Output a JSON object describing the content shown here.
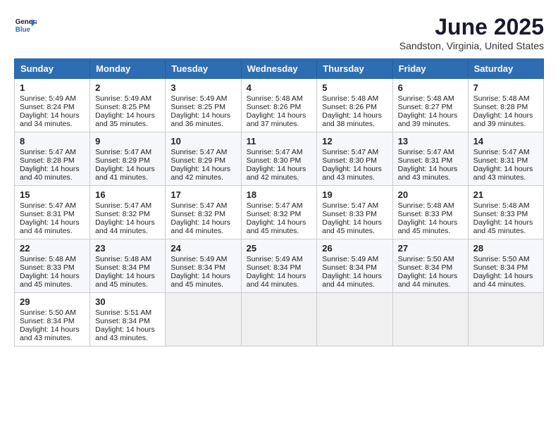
{
  "header": {
    "logo_line1": "General",
    "logo_line2": "Blue",
    "month_title": "June 2025",
    "location": "Sandston, Virginia, United States"
  },
  "weekdays": [
    "Sunday",
    "Monday",
    "Tuesday",
    "Wednesday",
    "Thursday",
    "Friday",
    "Saturday"
  ],
  "weeks": [
    [
      {
        "day": "1",
        "sunrise": "5:49 AM",
        "sunset": "8:24 PM",
        "daylight": "14 hours and 34 minutes."
      },
      {
        "day": "2",
        "sunrise": "5:49 AM",
        "sunset": "8:25 PM",
        "daylight": "14 hours and 35 minutes."
      },
      {
        "day": "3",
        "sunrise": "5:49 AM",
        "sunset": "8:25 PM",
        "daylight": "14 hours and 36 minutes."
      },
      {
        "day": "4",
        "sunrise": "5:48 AM",
        "sunset": "8:26 PM",
        "daylight": "14 hours and 37 minutes."
      },
      {
        "day": "5",
        "sunrise": "5:48 AM",
        "sunset": "8:26 PM",
        "daylight": "14 hours and 38 minutes."
      },
      {
        "day": "6",
        "sunrise": "5:48 AM",
        "sunset": "8:27 PM",
        "daylight": "14 hours and 39 minutes."
      },
      {
        "day": "7",
        "sunrise": "5:48 AM",
        "sunset": "8:28 PM",
        "daylight": "14 hours and 39 minutes."
      }
    ],
    [
      {
        "day": "8",
        "sunrise": "5:47 AM",
        "sunset": "8:28 PM",
        "daylight": "14 hours and 40 minutes."
      },
      {
        "day": "9",
        "sunrise": "5:47 AM",
        "sunset": "8:29 PM",
        "daylight": "14 hours and 41 minutes."
      },
      {
        "day": "10",
        "sunrise": "5:47 AM",
        "sunset": "8:29 PM",
        "daylight": "14 hours and 42 minutes."
      },
      {
        "day": "11",
        "sunrise": "5:47 AM",
        "sunset": "8:30 PM",
        "daylight": "14 hours and 42 minutes."
      },
      {
        "day": "12",
        "sunrise": "5:47 AM",
        "sunset": "8:30 PM",
        "daylight": "14 hours and 43 minutes."
      },
      {
        "day": "13",
        "sunrise": "5:47 AM",
        "sunset": "8:31 PM",
        "daylight": "14 hours and 43 minutes."
      },
      {
        "day": "14",
        "sunrise": "5:47 AM",
        "sunset": "8:31 PM",
        "daylight": "14 hours and 43 minutes."
      }
    ],
    [
      {
        "day": "15",
        "sunrise": "5:47 AM",
        "sunset": "8:31 PM",
        "daylight": "14 hours and 44 minutes."
      },
      {
        "day": "16",
        "sunrise": "5:47 AM",
        "sunset": "8:32 PM",
        "daylight": "14 hours and 44 minutes."
      },
      {
        "day": "17",
        "sunrise": "5:47 AM",
        "sunset": "8:32 PM",
        "daylight": "14 hours and 44 minutes."
      },
      {
        "day": "18",
        "sunrise": "5:47 AM",
        "sunset": "8:32 PM",
        "daylight": "14 hours and 45 minutes."
      },
      {
        "day": "19",
        "sunrise": "5:47 AM",
        "sunset": "8:33 PM",
        "daylight": "14 hours and 45 minutes."
      },
      {
        "day": "20",
        "sunrise": "5:48 AM",
        "sunset": "8:33 PM",
        "daylight": "14 hours and 45 minutes."
      },
      {
        "day": "21",
        "sunrise": "5:48 AM",
        "sunset": "8:33 PM",
        "daylight": "14 hours and 45 minutes."
      }
    ],
    [
      {
        "day": "22",
        "sunrise": "5:48 AM",
        "sunset": "8:33 PM",
        "daylight": "14 hours and 45 minutes."
      },
      {
        "day": "23",
        "sunrise": "5:48 AM",
        "sunset": "8:34 PM",
        "daylight": "14 hours and 45 minutes."
      },
      {
        "day": "24",
        "sunrise": "5:49 AM",
        "sunset": "8:34 PM",
        "daylight": "14 hours and 45 minutes."
      },
      {
        "day": "25",
        "sunrise": "5:49 AM",
        "sunset": "8:34 PM",
        "daylight": "14 hours and 44 minutes."
      },
      {
        "day": "26",
        "sunrise": "5:49 AM",
        "sunset": "8:34 PM",
        "daylight": "14 hours and 44 minutes."
      },
      {
        "day": "27",
        "sunrise": "5:50 AM",
        "sunset": "8:34 PM",
        "daylight": "14 hours and 44 minutes."
      },
      {
        "day": "28",
        "sunrise": "5:50 AM",
        "sunset": "8:34 PM",
        "daylight": "14 hours and 44 minutes."
      }
    ],
    [
      {
        "day": "29",
        "sunrise": "5:50 AM",
        "sunset": "8:34 PM",
        "daylight": "14 hours and 43 minutes."
      },
      {
        "day": "30",
        "sunrise": "5:51 AM",
        "sunset": "8:34 PM",
        "daylight": "14 hours and 43 minutes."
      },
      null,
      null,
      null,
      null,
      null
    ]
  ]
}
